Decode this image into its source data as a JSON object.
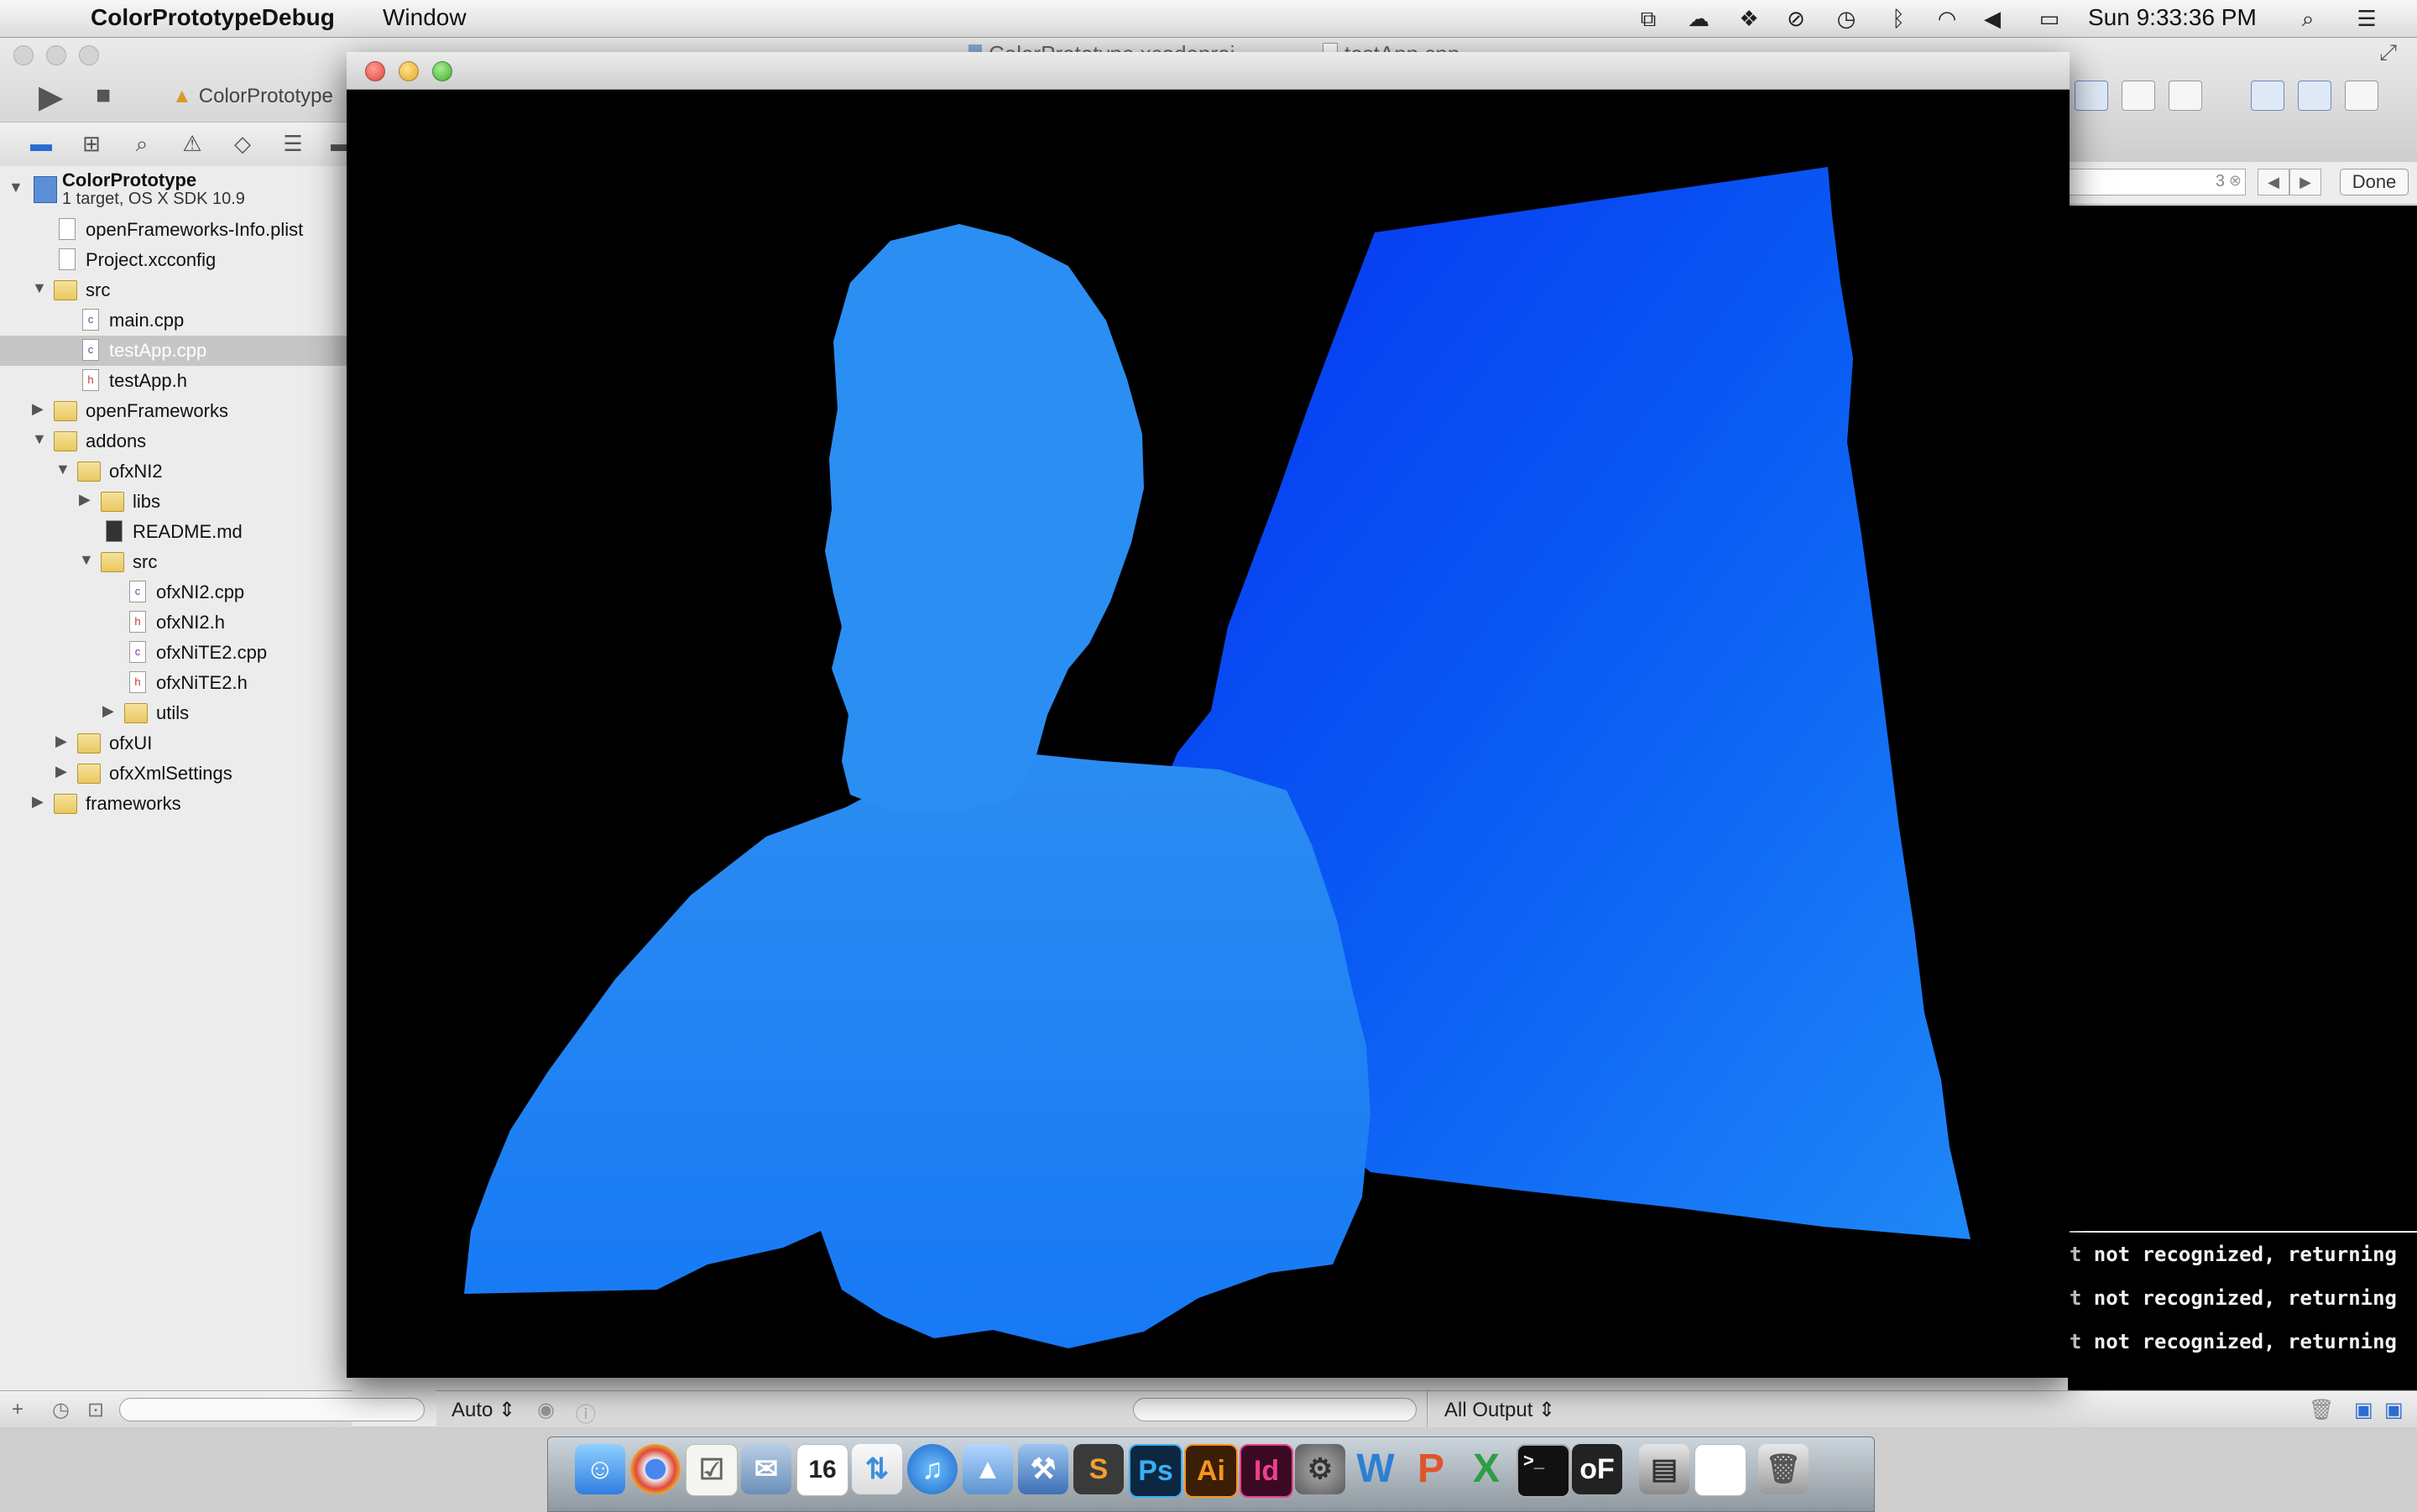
{
  "menubar": {
    "app_name": "ColorPrototypeDebug",
    "menus": [
      "Window"
    ],
    "clock": "Sun 9:33:36 PM"
  },
  "xcode": {
    "tabs": [
      "ColorPrototype.xcodeproj",
      "testApp.cpp"
    ],
    "scheme": "ColorPrototype",
    "find": {
      "count": "3",
      "done_label": "Done"
    },
    "navigator": {
      "project": {
        "name": "ColorPrototype",
        "subtitle": "1 target, OS X SDK 10.9"
      },
      "items": [
        {
          "label": "openFrameworks-Info.plist"
        },
        {
          "label": "Project.xcconfig"
        },
        {
          "label": "src"
        },
        {
          "label": "main.cpp"
        },
        {
          "label": "testApp.cpp"
        },
        {
          "label": "testApp.h"
        },
        {
          "label": "openFrameworks"
        },
        {
          "label": "addons"
        },
        {
          "label": "ofxNI2"
        },
        {
          "label": "libs"
        },
        {
          "label": "README.md"
        },
        {
          "label": "src"
        },
        {
          "label": "ofxNI2.cpp"
        },
        {
          "label": "ofxNI2.h"
        },
        {
          "label": "ofxNiTE2.cpp"
        },
        {
          "label": "ofxNiTE2.h"
        },
        {
          "label": "utils"
        },
        {
          "label": "ofxUI"
        },
        {
          "label": "ofxXmlSettings"
        },
        {
          "label": "frameworks"
        }
      ]
    },
    "debug_bar": {
      "variables_mode": "Auto",
      "output_mode": "All Output"
    },
    "console_lines": [
      "rmat not recognized, returning",
      "rmat not recognized, returning",
      "rmat not recognized, returning"
    ]
  },
  "colors": {
    "depth_light": "#2a90f2",
    "depth_dark": "#0a3cf0",
    "selection": "#c6c6c6"
  },
  "dock": {
    "apps": [
      "Finder",
      "Chrome",
      "Reminders",
      "Preview",
      "Calendar",
      "Transmit",
      "iTunes",
      "Keynote",
      "Xcode",
      "Sublime Text",
      "Photoshop",
      "Illustrator",
      "InDesign",
      "System Preferences",
      "Word",
      "PowerPoint",
      "Excel",
      "Terminal",
      "openFrameworks Debug",
      "Scanner",
      "Preview Document",
      "Trash"
    ],
    "calendar_day": "16",
    "app_labels": {
      "ps": "Ps",
      "ai": "Ai",
      "id": "Id"
    }
  }
}
